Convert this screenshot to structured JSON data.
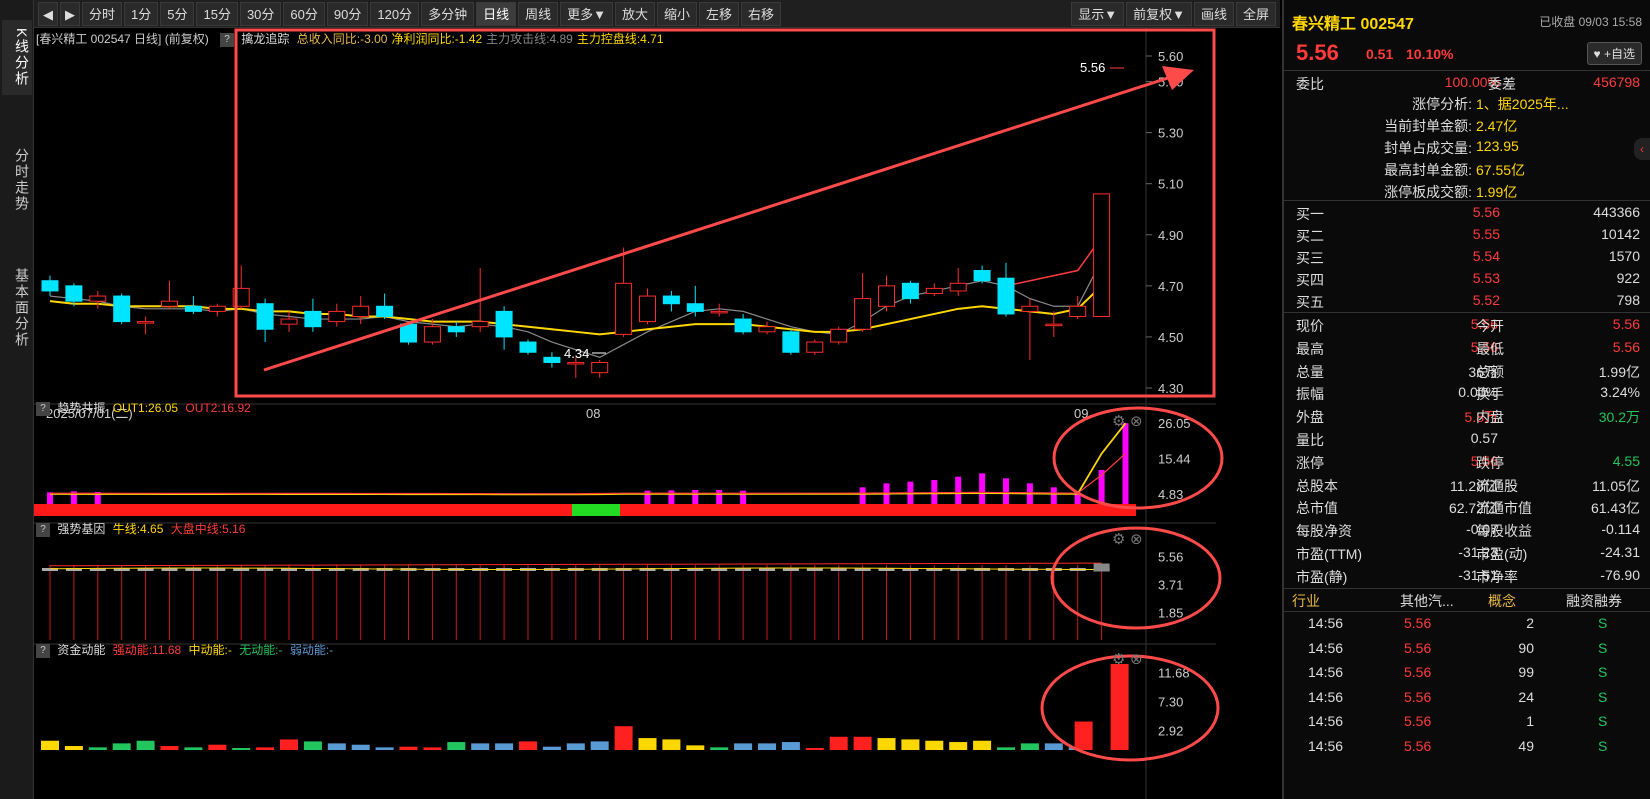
{
  "nav": {
    "kline": "K线分析",
    "fenshi": "分时走势",
    "jiben": "基本面分析"
  },
  "toolbar": {
    "items": [
      "分时",
      "1分",
      "5分",
      "15分",
      "30分",
      "60分",
      "90分",
      "120分",
      "多分钟",
      "日线",
      "周线",
      "更多▼",
      "放大",
      "缩小",
      "左移",
      "右移"
    ],
    "right": [
      "显示▼",
      "前复权▼",
      "画线",
      "全屏"
    ]
  },
  "main": {
    "title": "[春兴精工 002547 日线] (前复权)",
    "indicator_name": "擒龙追踪",
    "indicator_items": [
      {
        "text": "总收入同比:-3.00",
        "color": "#e8b84a"
      },
      {
        "text": "净利润同比:-1.42",
        "color": "#ffd700"
      },
      {
        "text": "主力攻击线:4.89",
        "color": "#888888"
      },
      {
        "text": "主力控盘线:4.71",
        "color": "#ffd700"
      }
    ],
    "y_ticks": [
      "5.60",
      "5.50",
      "5.30",
      "5.10",
      "4.90",
      "4.70",
      "4.50",
      "4.30"
    ],
    "x_labels": {
      "start": "2025/07/01(二)",
      "mid": "08",
      "end": "09"
    },
    "hi_label": "5.56",
    "lo_label": "4.34"
  },
  "panel2": {
    "name": "趋势共振",
    "out1": "OUT1:26.05",
    "out2": "OUT2:16.92",
    "ticks": [
      "26.05",
      "15.44",
      "4.83"
    ]
  },
  "panel3": {
    "name": "强势基因",
    "niu": "牛线:4.65",
    "dapan": "大盘中线:5.16",
    "ticks": [
      "5.56",
      "3.71",
      "1.85"
    ]
  },
  "panel4": {
    "name": "资金动能",
    "strong": "强动能:11.68",
    "mid": "中动能:-",
    "none": "无动能:-",
    "weak": "弱动能:-",
    "ticks": [
      "11.68",
      "7.30",
      "2.92"
    ]
  },
  "chart_data": {
    "type": "candlestick",
    "candles": [
      [
        4.72,
        4.68,
        4.74,
        4.66
      ],
      [
        4.7,
        4.64,
        4.71,
        4.62
      ],
      [
        4.64,
        4.66,
        4.68,
        4.61
      ],
      [
        4.66,
        4.56,
        4.67,
        4.55
      ],
      [
        4.56,
        4.56,
        4.58,
        4.51
      ],
      [
        4.62,
        4.64,
        4.72,
        4.61
      ],
      [
        4.62,
        4.6,
        4.66,
        4.59
      ],
      [
        4.6,
        4.62,
        4.63,
        4.58
      ],
      [
        4.62,
        4.69,
        4.78,
        4.61
      ],
      [
        4.63,
        4.53,
        4.65,
        4.48
      ],
      [
        4.55,
        4.57,
        4.6,
        4.52
      ],
      [
        4.6,
        4.54,
        4.65,
        4.52
      ],
      [
        4.56,
        4.6,
        4.63,
        4.54
      ],
      [
        4.58,
        4.62,
        4.66,
        4.55
      ],
      [
        4.62,
        4.58,
        4.67,
        4.57
      ],
      [
        4.55,
        4.48,
        4.56,
        4.47
      ],
      [
        4.48,
        4.54,
        4.57,
        4.47
      ],
      [
        4.54,
        4.52,
        4.56,
        4.5
      ],
      [
        4.54,
        4.56,
        4.77,
        4.52
      ],
      [
        4.6,
        4.5,
        4.62,
        4.45
      ],
      [
        4.48,
        4.44,
        4.49,
        4.43
      ],
      [
        4.42,
        4.4,
        4.44,
        4.38
      ],
      [
        4.4,
        4.4,
        4.42,
        4.34
      ],
      [
        4.36,
        4.4,
        4.41,
        4.34
      ],
      [
        4.51,
        4.71,
        4.85,
        4.5
      ],
      [
        4.56,
        4.66,
        4.69,
        4.55
      ],
      [
        4.66,
        4.63,
        4.68,
        4.6
      ],
      [
        4.63,
        4.6,
        4.7,
        4.58
      ],
      [
        4.6,
        4.6,
        4.63,
        4.58
      ],
      [
        4.57,
        4.52,
        4.59,
        4.51
      ],
      [
        4.52,
        4.54,
        4.56,
        4.51
      ],
      [
        4.52,
        4.44,
        4.53,
        4.43
      ],
      [
        4.44,
        4.48,
        4.49,
        4.43
      ],
      [
        4.48,
        4.53,
        4.54,
        4.47
      ],
      [
        4.53,
        4.65,
        4.75,
        4.52
      ],
      [
        4.62,
        4.7,
        4.74,
        4.6
      ],
      [
        4.71,
        4.65,
        4.72,
        4.63
      ],
      [
        4.67,
        4.69,
        4.71,
        4.66
      ],
      [
        4.68,
        4.71,
        4.77,
        4.66
      ],
      [
        4.76,
        4.72,
        4.78,
        4.71
      ],
      [
        4.73,
        4.59,
        4.79,
        4.58
      ],
      [
        4.6,
        4.62,
        4.65,
        4.41
      ],
      [
        4.55,
        4.55,
        4.6,
        4.5
      ],
      [
        4.58,
        4.62,
        4.66,
        4.57
      ],
      [
        4.58,
        5.06,
        5.06,
        4.58
      ]
    ],
    "ma_yellow": [
      4.64,
      4.63,
      4.63,
      4.62,
      4.62,
      4.62,
      4.62,
      4.61,
      4.61,
      4.6,
      4.6,
      4.59,
      4.59,
      4.58,
      4.58,
      4.57,
      4.56,
      4.56,
      4.56,
      4.55,
      4.54,
      4.53,
      4.52,
      4.51,
      4.52,
      4.53,
      4.54,
      4.55,
      4.55,
      4.55,
      4.54,
      4.53,
      4.52,
      4.52,
      4.53,
      4.55,
      4.57,
      4.59,
      4.61,
      4.62,
      4.61,
      4.6,
      4.59,
      4.61,
      4.7
    ],
    "ma_gray": [
      4.66,
      4.65,
      4.64,
      4.62,
      4.61,
      4.61,
      4.61,
      4.6,
      4.61,
      4.59,
      4.58,
      4.57,
      4.57,
      4.57,
      4.58,
      4.56,
      4.55,
      4.54,
      4.55,
      4.54,
      4.52,
      4.48,
      4.45,
      4.42,
      4.47,
      4.52,
      4.56,
      4.6,
      4.61,
      4.6,
      4.57,
      4.54,
      4.52,
      4.51,
      4.56,
      4.62,
      4.66,
      4.68,
      4.7,
      4.72,
      4.7,
      4.65,
      4.62,
      4.62,
      4.8
    ],
    "trend_y": [
      4.83,
      4.82,
      4.82,
      4.81,
      4.8,
      4.78,
      4.78,
      4.78,
      4.79,
      4.79,
      4.78,
      4.78,
      4.78,
      4.77,
      4.76,
      4.75,
      4.74,
      4.73,
      4.72,
      4.7,
      4.69,
      4.68,
      4.68,
      4.75,
      4.84,
      4.85,
      4.85,
      4.84,
      4.84,
      4.83,
      4.83,
      4.83,
      4.84,
      4.84,
      4.86,
      4.9,
      4.95,
      5.0,
      5.05,
      5.08,
      5.03,
      4.97,
      4.9,
      4.85,
      16.92,
      26.05
    ],
    "trend_bars": [
      5.3,
      5.6,
      5.4,
      0,
      0,
      0,
      0,
      0,
      0,
      0,
      0,
      0,
      0,
      0,
      0,
      0,
      0,
      0,
      0,
      0,
      0,
      0,
      0,
      0,
      0,
      5.8,
      5.9,
      6.0,
      6.0,
      5.8,
      0,
      0,
      0,
      0,
      6.8,
      8.0,
      8.5,
      9.0,
      10.0,
      11.0,
      9.5,
      8.0,
      6.8,
      5.0,
      12.0,
      26.05
    ],
    "zj_bars": [
      {
        "v": 1.4,
        "c": "#ffd700"
      },
      {
        "v": 0.6,
        "c": "#ffd700"
      },
      {
        "v": 0.4,
        "c": "#22c55e"
      },
      {
        "v": 1.0,
        "c": "#22c55e"
      },
      {
        "v": 1.4,
        "c": "#22c55e"
      },
      {
        "v": 0.6,
        "c": "#ff2020"
      },
      {
        "v": 0.4,
        "c": "#22c55e"
      },
      {
        "v": 0.8,
        "c": "#ff2020"
      },
      {
        "v": 0.3,
        "c": "#22c55e"
      },
      {
        "v": 0.4,
        "c": "#ff2020"
      },
      {
        "v": 1.6,
        "c": "#ff2020"
      },
      {
        "v": 1.3,
        "c": "#22c55e"
      },
      {
        "v": 1.0,
        "c": "#5b9bd5"
      },
      {
        "v": 0.8,
        "c": "#5b9bd5"
      },
      {
        "v": 0.4,
        "c": "#5b9bd5"
      },
      {
        "v": 0.5,
        "c": "#ff2020"
      },
      {
        "v": 0.4,
        "c": "#ff2020"
      },
      {
        "v": 1.2,
        "c": "#22c55e"
      },
      {
        "v": 1.0,
        "c": "#5b9bd5"
      },
      {
        "v": 1.0,
        "c": "#5b9bd5"
      },
      {
        "v": 1.3,
        "c": "#ff2020"
      },
      {
        "v": 0.5,
        "c": "#5b9bd5"
      },
      {
        "v": 1.0,
        "c": "#5b9bd5"
      },
      {
        "v": 1.3,
        "c": "#5b9bd5"
      },
      {
        "v": 3.6,
        "c": "#ff2020"
      },
      {
        "v": 1.8,
        "c": "#ffd700"
      },
      {
        "v": 1.6,
        "c": "#ffd700"
      },
      {
        "v": 0.7,
        "c": "#ffd700"
      },
      {
        "v": 0.4,
        "c": "#22c55e"
      },
      {
        "v": 1.0,
        "c": "#5b9bd5"
      },
      {
        "v": 1.0,
        "c": "#5b9bd5"
      },
      {
        "v": 1.2,
        "c": "#5b9bd5"
      },
      {
        "v": 0.3,
        "c": "#ff2020"
      },
      {
        "v": 2.0,
        "c": "#ff2020"
      },
      {
        "v": 2.0,
        "c": "#ff2020"
      },
      {
        "v": 1.8,
        "c": "#ffd700"
      },
      {
        "v": 1.6,
        "c": "#ffd700"
      },
      {
        "v": 1.4,
        "c": "#ffd700"
      },
      {
        "v": 1.2,
        "c": "#ffd700"
      },
      {
        "v": 1.4,
        "c": "#ffd700"
      },
      {
        "v": 0.4,
        "c": "#22c55e"
      },
      {
        "v": 1.0,
        "c": "#22c55e"
      },
      {
        "v": 1.0,
        "c": "#5b9bd5"
      },
      {
        "v": 0.4,
        "c": "#5b9bd5"
      },
      {
        "v": 4.3,
        "c": "#ff2020"
      },
      {
        "v": 13.0,
        "c": "#ff2020"
      }
    ]
  },
  "colors": {
    "up": "#ff2a2a",
    "down": "#00e5ff",
    "annot": "#ff4a4a",
    "magenta": "#ff00ff",
    "yellow": "#ffd700"
  },
  "quote": {
    "name": "春兴精工",
    "code": "002547",
    "prev_label": "已收盘 09/03 15:58",
    "price": "5.56",
    "change": "0.51",
    "pct": "10.10%",
    "watch": "+自选",
    "weibi_label": "委比",
    "weibi": "100.00%",
    "weicha_label": "委差",
    "weicha": "456798",
    "zt": [
      {
        "l": "涨停分析:",
        "v": "1、据2025年..."
      },
      {
        "l": "当前封单金额:",
        "v": "2.47亿"
      },
      {
        "l": "封单占成交量:",
        "v": "123.95"
      },
      {
        "l": "最高封单金额:",
        "v": "67.55亿"
      },
      {
        "l": "涨停板成交额:",
        "v": "1.99亿"
      }
    ],
    "bids": [
      {
        "l": "买一",
        "p": "5.56",
        "v": "443366"
      },
      {
        "l": "买二",
        "p": "5.55",
        "v": "10142"
      },
      {
        "l": "买三",
        "p": "5.54",
        "v": "1570"
      },
      {
        "l": "买四",
        "p": "5.53",
        "v": "922"
      },
      {
        "l": "买五",
        "p": "5.52",
        "v": "798"
      }
    ],
    "stats": [
      [
        {
          "l": "现价",
          "v": "5.56",
          "c": "red"
        },
        {
          "l": "今开",
          "v": "5.56",
          "c": "red"
        }
      ],
      [
        {
          "l": "最高",
          "v": "5.56",
          "c": "red"
        },
        {
          "l": "最低",
          "v": "5.56",
          "c": "red"
        }
      ],
      [
        {
          "l": "总量",
          "v": "36万",
          "c": "white"
        },
        {
          "l": "总额",
          "v": "1.99亿",
          "c": "white"
        }
      ],
      [
        {
          "l": "振幅",
          "v": "0.00%",
          "c": "white"
        },
        {
          "l": "换手",
          "v": "3.24%",
          "c": "white"
        }
      ],
      [
        {
          "l": "外盘",
          "v": "5.8万",
          "c": "red"
        },
        {
          "l": "内盘",
          "v": "30.2万",
          "c": "green"
        }
      ],
      [
        {
          "l": "量比",
          "v": "0.57",
          "c": "white"
        },
        {
          "l": "",
          "v": "",
          "c": "white"
        }
      ],
      [
        {
          "l": "涨停",
          "v": "5.56",
          "c": "red"
        },
        {
          "l": "跌停",
          "v": "4.55",
          "c": "green"
        }
      ],
      [
        {
          "l": "总股本",
          "v": "11.28亿",
          "c": "white"
        },
        {
          "l": "流通股",
          "v": "11.05亿",
          "c": "white"
        }
      ],
      [
        {
          "l": "总市值",
          "v": "62.72亿",
          "c": "white"
        },
        {
          "l": "流通市值",
          "v": "61.43亿",
          "c": "white"
        }
      ],
      [
        {
          "l": "每股净资",
          "v": "-0.07",
          "c": "white"
        },
        {
          "l": "每股收益",
          "v": "-0.114",
          "c": "white"
        }
      ],
      [
        {
          "l": "市盈(TTM)",
          "v": "-31.23",
          "c": "white"
        },
        {
          "l": "市盈(动)",
          "v": "-24.31",
          "c": "white"
        }
      ],
      [
        {
          "l": "市盈(静)",
          "v": "-31.51",
          "c": "white"
        },
        {
          "l": "市净率",
          "v": "-76.90",
          "c": "white"
        }
      ]
    ],
    "tabs": [
      "行业",
      "其他汽...",
      "概念",
      "融资融券"
    ],
    "ticks": [
      {
        "t": "14:56",
        "p": "5.56",
        "v": "2",
        "s": "S"
      },
      {
        "t": "14:56",
        "p": "5.56",
        "v": "90",
        "s": "S"
      },
      {
        "t": "14:56",
        "p": "5.56",
        "v": "99",
        "s": "S"
      },
      {
        "t": "14:56",
        "p": "5.56",
        "v": "24",
        "s": "S"
      },
      {
        "t": "14:56",
        "p": "5.56",
        "v": "1",
        "s": "S"
      },
      {
        "t": "14:56",
        "p": "5.56",
        "v": "49",
        "s": "S"
      }
    ]
  }
}
